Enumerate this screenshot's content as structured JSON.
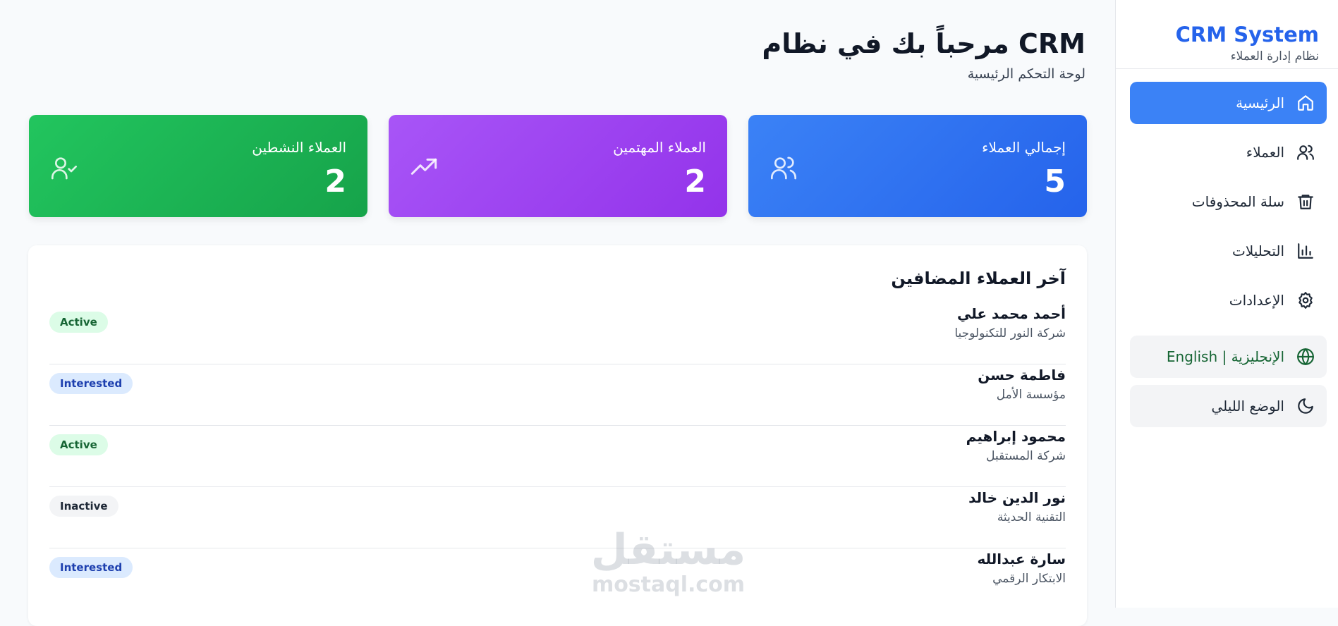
{
  "sidebar": {
    "brand_title": "CRM System",
    "brand_subtitle": "نظام إدارة العملاء",
    "items": [
      {
        "label": "الرئيسية",
        "icon": "home-icon"
      },
      {
        "label": "العملاء",
        "icon": "users-icon"
      },
      {
        "label": "سلة المحذوفات",
        "icon": "trash-icon"
      },
      {
        "label": "التحليلات",
        "icon": "bar-chart-icon"
      },
      {
        "label": "الإعدادات",
        "icon": "gear-icon"
      }
    ],
    "language_toggle": "English | الإنجليزية",
    "dark_mode_toggle": "الوضع الليلي"
  },
  "header": {
    "title": "مرحباً بك في نظام CRM",
    "subtitle": "لوحة التحكم الرئيسية"
  },
  "stats": [
    {
      "label": "إجمالي العملاء",
      "value": "5",
      "icon": "users-icon",
      "color": "#3b82f6"
    },
    {
      "label": "العملاء المهتمين",
      "value": "2",
      "icon": "trending-up-icon",
      "color": "#a855f7"
    },
    {
      "label": "العملاء النشطين",
      "value": "2",
      "icon": "user-check-icon",
      "color": "#22c55e"
    }
  ],
  "recent": {
    "title": "آخر العملاء المضافين",
    "rows": [
      {
        "name": "أحمد محمد علي",
        "company": "شركة النور للتكنولوجيا",
        "status": "Active"
      },
      {
        "name": "فاطمة حسن",
        "company": "مؤسسة الأمل",
        "status": "Interested"
      },
      {
        "name": "محمود إبراهيم",
        "company": "شركة المستقبل",
        "status": "Active"
      },
      {
        "name": "نور الدين خالد",
        "company": "التقنية الحديثة",
        "status": "Inactive"
      },
      {
        "name": "سارة عبدالله",
        "company": "الابتكار الرقمي",
        "status": "Interested"
      }
    ]
  },
  "watermark": {
    "arabic": "مستقل",
    "latin": "mostaql.com"
  }
}
